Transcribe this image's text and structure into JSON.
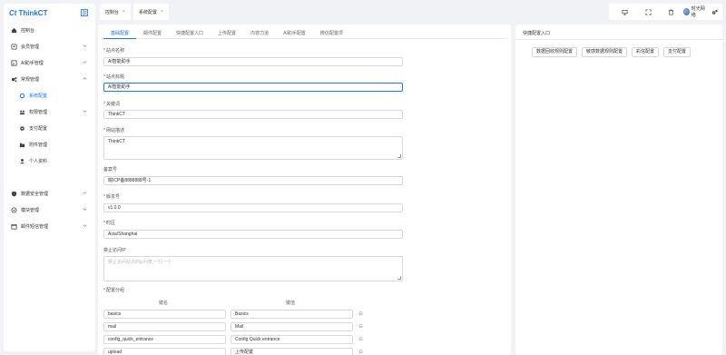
{
  "app": {
    "logo_mark": "Ct",
    "logo_text": "ThinkCT"
  },
  "sidebar": {
    "items": [
      {
        "label": "控制台",
        "icon": "home-icon"
      },
      {
        "label": "会员管理",
        "icon": "users-icon"
      },
      {
        "label": "AI助手管理",
        "icon": "robot-icon"
      },
      {
        "label": "常规管理",
        "icon": "cogs-icon"
      },
      {
        "label": "系统配置",
        "icon": "dot-icon"
      },
      {
        "label": "权限管理",
        "icon": "group-icon"
      },
      {
        "label": "支付配置",
        "icon": "gear-icon"
      },
      {
        "label": "附件管理",
        "icon": "folder-icon"
      },
      {
        "label": "个人资料",
        "icon": "user-icon"
      },
      {
        "label": "数据安全管理",
        "icon": "shield-icon"
      },
      {
        "label": "模块管理",
        "icon": "module-icon"
      },
      {
        "label": "邮件短信管理",
        "icon": "calendar-icon"
      }
    ]
  },
  "topbar": {
    "tabs": [
      {
        "label": "控制台"
      },
      {
        "label": "系统配置"
      }
    ],
    "user_name": "时光网络"
  },
  "form": {
    "tabs": [
      "基础配置",
      "邮件配置",
      "快捷配置入口",
      "上传配置",
      "内容力道",
      "AI助手配置",
      "微信配置项"
    ],
    "fields": {
      "site_name": {
        "label": "站点名称",
        "value": "AI智能助手"
      },
      "site_title": {
        "label": "站点标题",
        "value": "AI智能助手"
      },
      "keywords": {
        "label": "关键词",
        "value": "ThinkCT"
      },
      "description": {
        "label": "网站描述",
        "value": "ThinkCT"
      },
      "record_no": {
        "label": "备案号",
        "value": "皖ICP备8888888号-1"
      },
      "version": {
        "label": "版本号",
        "value": "v1.0.0"
      },
      "timezone": {
        "label": "时区",
        "value": "Asia/Shanghai"
      },
      "no_access_ip": {
        "label": "禁止访问IP",
        "placeholder": "禁止访问站点的ip列表,一行一个"
      },
      "config_group": {
        "label": "配置分组"
      }
    },
    "kv_headers": {
      "key": "键名",
      "value": "键值"
    },
    "kv_rows": [
      {
        "key": "basics",
        "value": "Basics"
      },
      {
        "key": "mail",
        "value": "Mail"
      },
      {
        "key": "config_quick_entrance",
        "value": "Config Quick entrance"
      },
      {
        "key": "upload",
        "value": "上传配置"
      }
    ]
  },
  "quick_entry": {
    "title": "快捷配置入口",
    "buttons": [
      "数据回收规则配置",
      "敏感数据规则配置",
      "彩信配置",
      "支付配置"
    ]
  },
  "colors": {
    "accent": "#1677ff",
    "background": "#f0f2f5"
  }
}
